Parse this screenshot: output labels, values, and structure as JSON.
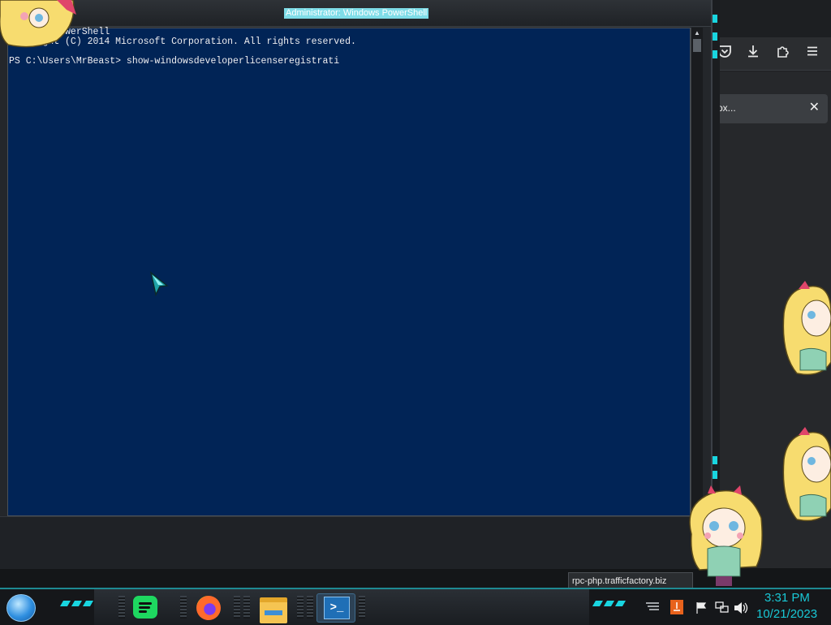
{
  "powershell": {
    "title": "Administrator: Windows PowerShell",
    "lines": [
      "Windows PowerShell",
      "Copyright (C) 2014 Microsoft Corporation. All rights reserved.",
      "",
      "PS C:\\Users\\MrBeast> show-windowsdeveloperlicenseregistrati"
    ]
  },
  "browser": {
    "notification_text": "ox...",
    "notification_close": "✕",
    "toolbar_icons": [
      "pocket-icon",
      "download-icon",
      "extensions-icon",
      "menu-icon"
    ]
  },
  "tooltip": {
    "text": "rpc-php.trafficfactory.biz"
  },
  "taskbar": {
    "apps": [
      {
        "name": "Spotify",
        "icon": "spotify-icon"
      },
      {
        "name": "Firefox",
        "icon": "firefox-icon"
      },
      {
        "name": "File Explorer",
        "icon": "file-explorer-icon"
      },
      {
        "name": "Windows PowerShell",
        "icon": "powershell-icon",
        "active": true
      }
    ],
    "tray_icons": [
      "overflow-icon",
      "java-update-icon",
      "action-center-flag-icon",
      "network-icon",
      "volume-icon"
    ],
    "clock": {
      "time": "3:31 PM",
      "date": "10/21/2023"
    }
  },
  "colors": {
    "console_bg": "#012456",
    "console_text": "#eeedf0",
    "accent_cyan": "#19d5e0",
    "clock_text": "#19c8d6"
  }
}
